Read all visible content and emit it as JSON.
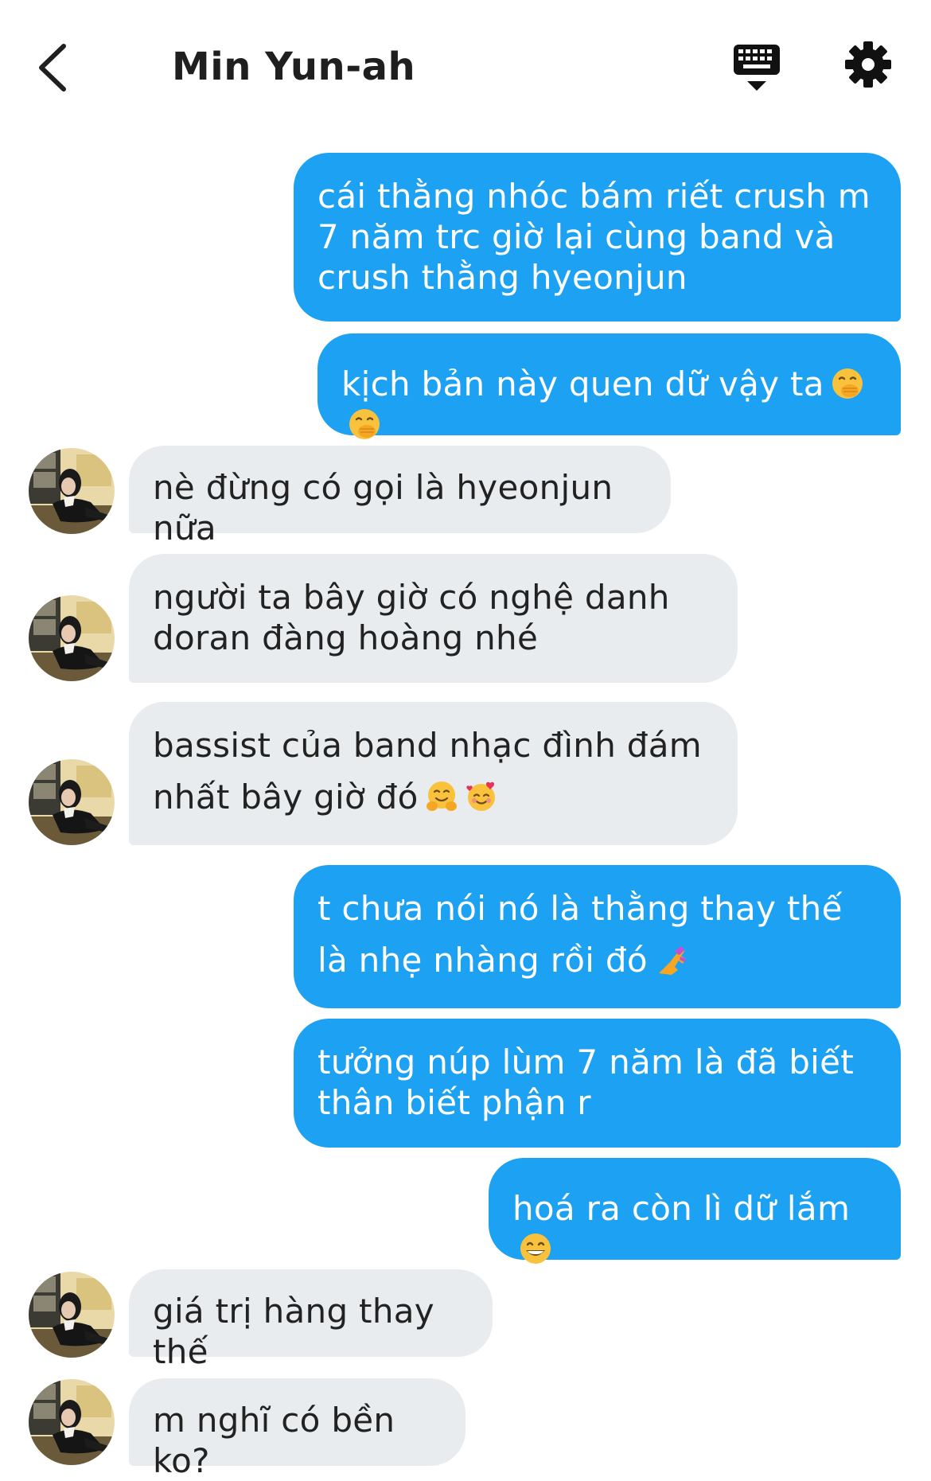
{
  "header": {
    "title": "Min Yun-ah",
    "back_icon": "chevron-left-icon",
    "keyboard_icon": "keyboard-icon",
    "settings_icon": "gear-icon"
  },
  "colors": {
    "sent_bubble": "#1da1f2",
    "received_bubble": "#e8ecef",
    "sent_text": "#ffffff",
    "received_text": "#222222"
  },
  "messages": [
    {
      "direction": "sent",
      "text": "cái thằng nhóc bám riết crush m 7 năm trc giờ lại cùng band và crush thằng hyeonjun"
    },
    {
      "direction": "sent",
      "text": "kịch bản này quen dữ vậy ta",
      "emojis": [
        "face-with-hand-over-mouth",
        "face-with-hand-over-mouth"
      ]
    },
    {
      "direction": "received",
      "text": "nè đừng có gọi là hyeonjun nữa"
    },
    {
      "direction": "received",
      "text": "người ta bây giờ có nghệ danh doran đàng hoàng nhé"
    },
    {
      "direction": "received",
      "text": "bassist của band nhạc đình đám nhất bây giờ đó",
      "emojis": [
        "hugging-face",
        "smiling-face-with-hearts"
      ]
    },
    {
      "direction": "sent",
      "text": "t chưa nói nó là thằng thay thế là nhẹ nhàng rồi đó",
      "emojis": [
        "nail-polish"
      ]
    },
    {
      "direction": "sent",
      "text": "tưởng núp lùm 7 năm là đã biết thân biết phận r"
    },
    {
      "direction": "sent",
      "text": "hoá ra còn lì dữ lắm",
      "emojis": [
        "grinning-face"
      ]
    },
    {
      "direction": "received",
      "text": "giá trị hàng thay thế"
    },
    {
      "direction": "received",
      "text": "m nghĩ có bền ko?"
    }
  ]
}
